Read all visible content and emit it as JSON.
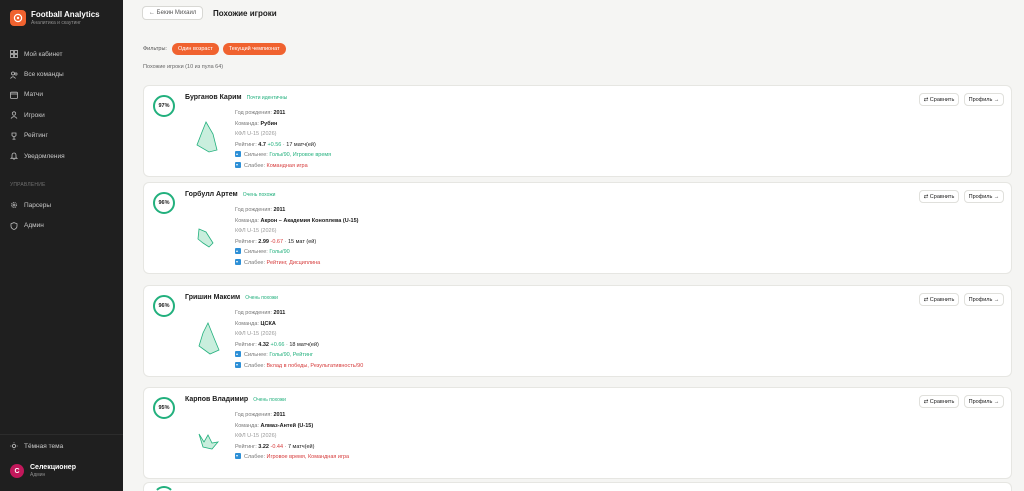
{
  "app": {
    "title": "Football Analytics",
    "subtitle": "Аналитика и скаутинг"
  },
  "sidebar": {
    "items": [
      {
        "label": "Мой кабинет",
        "icon": "grid-icon"
      },
      {
        "label": "Все команды",
        "icon": "users-icon"
      },
      {
        "label": "Матчи",
        "icon": "calendar-icon"
      },
      {
        "label": "Игроки",
        "icon": "user-icon"
      },
      {
        "label": "Рейтинг",
        "icon": "trophy-icon"
      },
      {
        "label": "Уведомления",
        "icon": "bell-icon"
      }
    ],
    "section_label": "УПРАВЛЕНИЕ",
    "items2": [
      {
        "label": "Парсеры",
        "icon": "gear-icon"
      },
      {
        "label": "Админ",
        "icon": "shield-icon"
      }
    ],
    "theme_label": "Тёмная тема",
    "user": {
      "initial": "С",
      "name": "Селекционер",
      "role": "Админ"
    }
  },
  "header": {
    "back_label": "← Бекин Михаил",
    "title": "Похожие игроки"
  },
  "filters": {
    "label": "Фильтры:",
    "chips": [
      {
        "label": "Один возраст"
      },
      {
        "label": "Текущий чемпионат"
      }
    ]
  },
  "results_count": "Похожие игроки (10 из пула 64)",
  "labels": {
    "birth_year": "Год рождения:",
    "team": "Команда:",
    "rating": "Рейтинг:",
    "stronger": "Сильнее:",
    "weaker": "Слабее:",
    "compare": "⇄ Сравнить",
    "profile": "Профиль →"
  },
  "players": [
    {
      "score": "97%",
      "name": "Бурганов Карим",
      "badge": "Почти идентичны",
      "birth_year": "2011",
      "team": "Рубин",
      "league": "КФЛ U-15 (2026)",
      "rating": "4.7",
      "rating_delta": "+0.56",
      "matches": "17 матч(ей)",
      "stronger": "Голы/90, Игровое время",
      "weaker": "Командная игра"
    },
    {
      "score": "96%",
      "name": "Горбулл Артем",
      "badge": "Очень похожи",
      "birth_year": "2011",
      "team": "Акрон – Академия Коноплева (U-15)",
      "league": "КФЛ U-15 (2026)",
      "rating": "2.99",
      "rating_delta": "-0.67",
      "matches": "15 мат (ей)",
      "stronger": "Голы/90",
      "weaker": "Рейтинг, Дисциплина"
    },
    {
      "score": "96%",
      "name": "Гришин Максим",
      "badge": "Очень похожи",
      "birth_year": "2011",
      "team": "ЦСКА",
      "league": "КФЛ U-15 (2026)",
      "rating": "4.32",
      "rating_delta": "+0.66",
      "matches": "18 матч(ей)",
      "stronger": "Голы/90, Рейтинг",
      "weaker": "Вклад в победы, Результативность/90"
    },
    {
      "score": "95%",
      "name": "Карпов Владимир",
      "badge": "Очень похожи",
      "birth_year": "2011",
      "team": "Алмаз-Антей (U-15)",
      "league": "КФЛ U-15 (2026)",
      "rating": "3.22",
      "rating_delta": "-0.44",
      "matches": "7 матч(ей)",
      "stronger": "Игровое время, Командная игра",
      "weaker": ""
    }
  ],
  "colors": {
    "accent": "#f0622f",
    "similar": "#22b07d",
    "weak": "#d63b3b",
    "sidebar": "#1f1f1f"
  }
}
